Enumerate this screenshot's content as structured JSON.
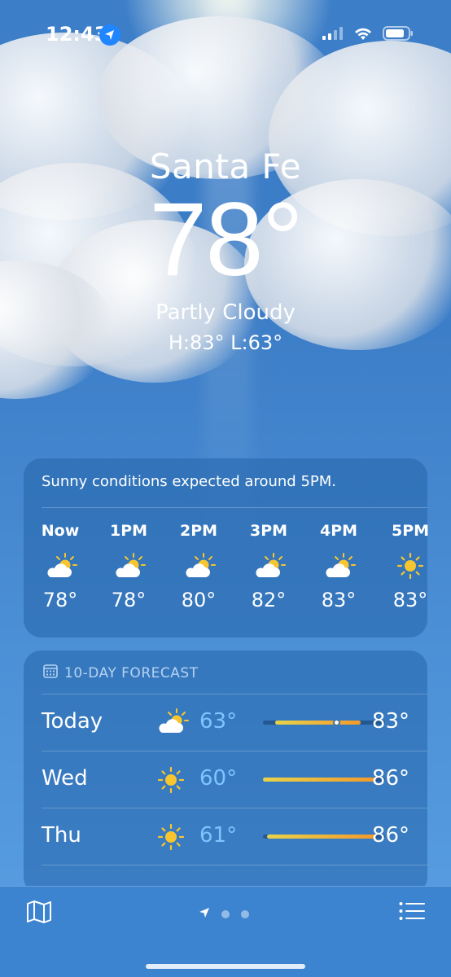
{
  "status_bar": {
    "time": "12:43"
  },
  "hero": {
    "city": "Santa Fe",
    "temperature": "78°",
    "condition": "Partly Cloudy",
    "high_low": "H:83°  L:63°"
  },
  "hourly": {
    "summary": "Sunny conditions expected around 5PM.",
    "hours": [
      {
        "label": "Now",
        "icon": "partly-cloudy-icon",
        "temp": "78°"
      },
      {
        "label": "1PM",
        "icon": "partly-cloudy-icon",
        "temp": "78°"
      },
      {
        "label": "2PM",
        "icon": "partly-cloudy-icon",
        "temp": "80°"
      },
      {
        "label": "3PM",
        "icon": "partly-cloudy-icon",
        "temp": "82°"
      },
      {
        "label": "4PM",
        "icon": "partly-cloudy-icon",
        "temp": "83°"
      },
      {
        "label": "5PM",
        "icon": "sun-icon",
        "temp": "83°"
      }
    ]
  },
  "daily": {
    "title": "10-DAY FORECAST",
    "days": [
      {
        "day": "Today",
        "icon": "partly-cloudy-icon",
        "low": "63°",
        "high": "83°",
        "range_start": 0.1,
        "range_end": 0.8,
        "current_marker": 0.6
      },
      {
        "day": "Wed",
        "icon": "sun-icon",
        "low": "60°",
        "high": "86°",
        "range_start": 0.0,
        "range_end": 0.92
      },
      {
        "day": "Thu",
        "icon": "sun-icon",
        "low": "61°",
        "high": "86°",
        "range_start": 0.03,
        "range_end": 0.92
      }
    ]
  },
  "colors": {
    "accent_blue": "#1f86ff",
    "low_temp": "#7fc4ff",
    "bar_warm_start": "#e8d34a",
    "bar_warm_end": "#f29a2c"
  }
}
